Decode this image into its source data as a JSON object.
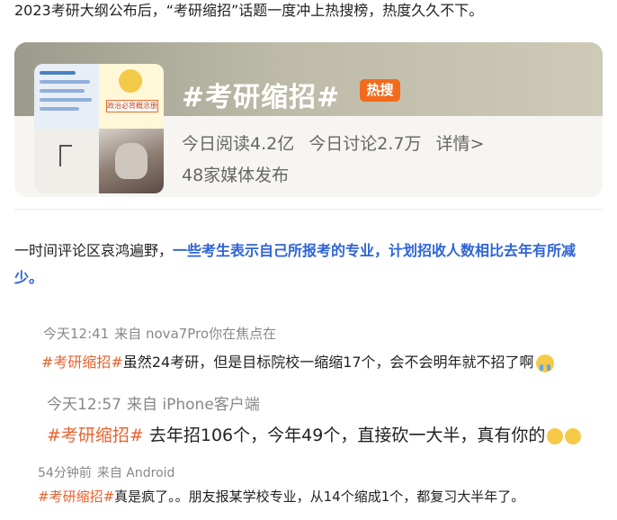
{
  "intro": "2023考研大纲公布后，“考研缩招”话题一度冲上热搜榜，热度久久不下。",
  "topic_card": {
    "hashtag": "#考研缩招#",
    "hot_badge": "热搜",
    "thumb_label": "政治必背概念册",
    "reads": "今日阅读4.2亿",
    "discussions": "今日讨论2.7万",
    "details": "详情>",
    "media": "48家媒体发布"
  },
  "paragraph": {
    "plain": "一时间评论区哀鸿遍野，",
    "highlight": "一些考生表示自己所报考的专业，计划招收人数相比去年有所减少。"
  },
  "comments": [
    {
      "time": "今天12:41",
      "source": "来自 nova7Pro你在焦点在",
      "tag": "#考研缩招#",
      "text": "虽然24考研，但是目标院校一缩缩17个，会不会明年就不招了啊",
      "emoji": [
        "crying-face-icon"
      ]
    },
    {
      "time": "今天12:57",
      "source": "来自 iPhone客户端",
      "tag": "#考研缩招#",
      "text": " 去年招106个，今年49个，直接砍一大半，真有你的",
      "emoji": [
        "upside-down-face-icon",
        "upside-down-face-icon"
      ]
    },
    {
      "time": "54分钟前",
      "source": "来自 Android",
      "tag": "#考研缩招#",
      "text": "真是疯了。。朋友报某学校专业，从14个缩成1个，都复习大半年了。",
      "emoji": []
    }
  ],
  "colors": {
    "hashtag_orange": "#e8622e",
    "highlight_blue": "#2f64d8",
    "hot_badge": "#f26b1d"
  }
}
